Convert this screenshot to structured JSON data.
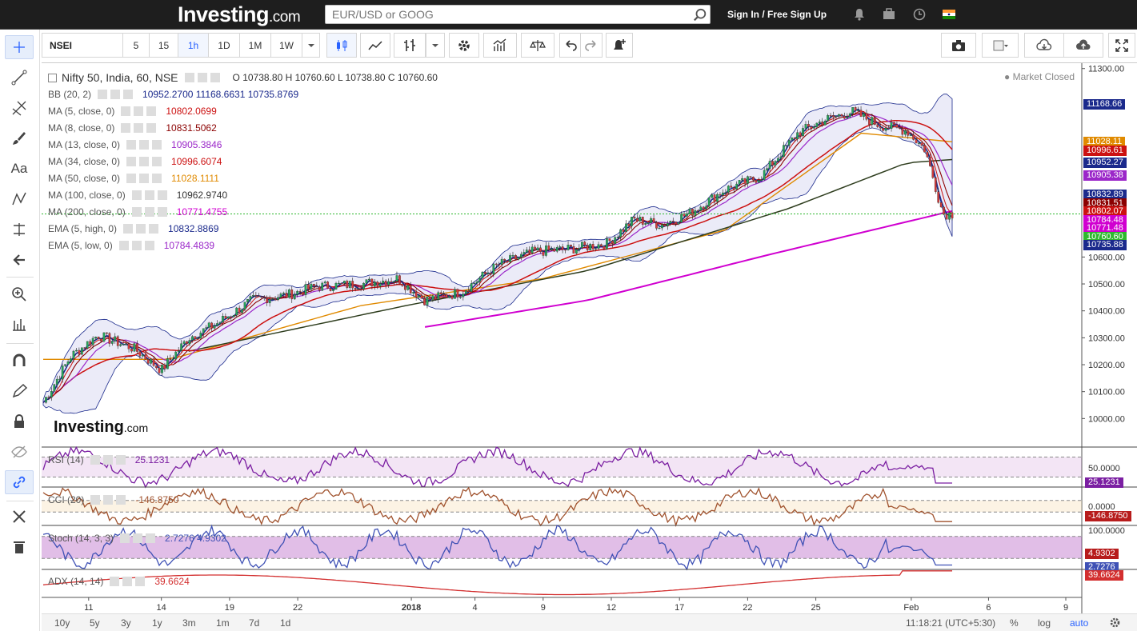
{
  "header": {
    "logo": "Investing",
    "logo_suffix": ".com",
    "search_placeholder": "EUR/USD or GOOG",
    "sign_in": "Sign In",
    "separator": "/",
    "sign_up": "Free Sign Up"
  },
  "toolbar": {
    "symbol": "NSEI",
    "intervals": [
      "5",
      "15",
      "1h",
      "1D",
      "1M",
      "1W"
    ],
    "selected_interval": "1h"
  },
  "legend": {
    "title": "Nifty 50, India, 60, NSE",
    "ohlc": "O 10738.80 H 10760.60 L 10738.80 C 10760.60",
    "market_status": "Market Closed",
    "indicators": [
      {
        "label": "BB (20, 2)",
        "value": "10952.2700  11168.6631  10735.8769",
        "color": "#1b2a8c"
      },
      {
        "label": "MA (5, close, 0)",
        "value": "10802.0699",
        "color": "#cc1111"
      },
      {
        "label": "MA (8, close, 0)",
        "value": "10831.5062",
        "color": "#8b0000"
      },
      {
        "label": "MA (13, close, 0)",
        "value": "10905.3846",
        "color": "#9b27c9"
      },
      {
        "label": "MA (34, close, 0)",
        "value": "10996.6074",
        "color": "#cc1111"
      },
      {
        "label": "MA (50, close, 0)",
        "value": "11028.1111",
        "color": "#e08a00"
      },
      {
        "label": "MA (100, close, 0)",
        "value": "10962.9740",
        "color": "#333333"
      },
      {
        "label": "MA (200, close, 0)",
        "value": "10771.4755",
        "color": "#d000d0"
      },
      {
        "label": "EMA (5, high, 0)",
        "value": "10832.8869",
        "color": "#1b2a8c"
      },
      {
        "label": "EMA (5, low, 0)",
        "value": "10784.4839",
        "color": "#9b27c9"
      }
    ]
  },
  "watermark": {
    "text": "Investing",
    "suffix": ".com"
  },
  "chart_data": [
    {
      "type": "candlestick",
      "name": "Nifty 50 60min",
      "x_ticks": [
        "11",
        "14",
        "19",
        "22",
        "2018",
        "4",
        "9",
        "12",
        "17",
        "22",
        "25",
        "Feb",
        "6",
        "9"
      ],
      "y_ticks": [
        "11300.00",
        "10600.00",
        "10500.00",
        "10400.00",
        "10300.00",
        "10200.00",
        "10100.00",
        "10000.00"
      ],
      "ylim": [
        9900,
        11320
      ],
      "close_path": [
        [
          0,
          10060
        ],
        [
          0.03,
          10230
        ],
        [
          0.06,
          10310
        ],
        [
          0.1,
          10260
        ],
        [
          0.13,
          10180
        ],
        [
          0.16,
          10300
        ],
        [
          0.19,
          10350
        ],
        [
          0.23,
          10440
        ],
        [
          0.27,
          10460
        ],
        [
          0.3,
          10490
        ],
        [
          0.35,
          10500
        ],
        [
          0.39,
          10520
        ],
        [
          0.42,
          10440
        ],
        [
          0.46,
          10470
        ],
        [
          0.5,
          10570
        ],
        [
          0.54,
          10620
        ],
        [
          0.58,
          10630
        ],
        [
          0.62,
          10650
        ],
        [
          0.65,
          10740
        ],
        [
          0.68,
          10720
        ],
        [
          0.71,
          10760
        ],
        [
          0.75,
          10850
        ],
        [
          0.79,
          10900
        ],
        [
          0.83,
          11060
        ],
        [
          0.86,
          11110
        ],
        [
          0.89,
          11140
        ],
        [
          0.92,
          11090
        ],
        [
          0.95,
          11070
        ],
        [
          0.97,
          11000
        ],
        [
          0.99,
          10760
        ]
      ],
      "ma200_path": [
        [
          0.42,
          10340
        ],
        [
          0.6,
          10440
        ],
        [
          0.8,
          10610
        ],
        [
          1,
          10771
        ]
      ],
      "ma100_path": [
        [
          0.16,
          10250
        ],
        [
          0.4,
          10420
        ],
        [
          0.6,
          10550
        ],
        [
          0.82,
          10780
        ],
        [
          0.95,
          10950
        ],
        [
          1,
          10962
        ]
      ],
      "ma50_path": [
        [
          0,
          10220
        ],
        [
          0.14,
          10220
        ],
        [
          0.35,
          10420
        ],
        [
          0.55,
          10520
        ],
        [
          0.75,
          10700
        ],
        [
          0.9,
          11060
        ],
        [
          1,
          11028
        ]
      ],
      "price_labels": [
        {
          "text": "11028.11",
          "value": 11028,
          "color": "#e08a00"
        },
        {
          "text": "10996.61",
          "value": 10996,
          "color": "#cc1111"
        },
        {
          "text": "11168.66",
          "value": 11168,
          "color": "#1b2a8c"
        },
        {
          "text": "10952.27",
          "value": 10952,
          "color": "#1b2a8c"
        },
        {
          "text": "10905.38",
          "value": 10905,
          "color": "#9b27c9"
        },
        {
          "text": "10832.89",
          "value": 10832,
          "color": "#1b2a8c"
        },
        {
          "text": "10831.51",
          "value": 10831,
          "color": "#8b0000"
        },
        {
          "text": "10802.07",
          "value": 10802,
          "color": "#cc1111"
        },
        {
          "text": "10784.48",
          "value": 10784,
          "color": "#d000d0"
        },
        {
          "text": "10771.48",
          "value": 10771,
          "color": "#d000d0"
        },
        {
          "text": "10760.60",
          "value": 10760,
          "color": "#2eb82e"
        },
        {
          "text": "10735.88",
          "value": 10735,
          "color": "#1b2a8c"
        }
      ]
    },
    {
      "type": "line",
      "name": "RSI (14)",
      "value_label": "25.1231",
      "series_value": 25.1231,
      "y_ticks": [
        "50.0000"
      ],
      "color": "#7b1fa2"
    },
    {
      "type": "line",
      "name": "CCI (20)",
      "value_label": "-146.8750",
      "series_value": -146.875,
      "y_ticks": [
        "0.0000"
      ],
      "color": "#a0522d"
    },
    {
      "type": "line",
      "name": "Stoch (14, 3, 3)",
      "value_label": "2.7276  4.9302",
      "k": 2.7276,
      "d": 4.9302,
      "y_ticks": [
        "100.0000"
      ],
      "color": "#3f51b5"
    },
    {
      "type": "line",
      "name": "ADX (14, 14)",
      "value_label": "39.6624",
      "series_value": 39.6624,
      "color": "#d32f2f"
    }
  ],
  "indicator_labels": {
    "rsi_name": "RSI (14)",
    "rsi_val": "25.1231",
    "rsi_tick": "50.0000",
    "rsi_right": "25.1231",
    "cci_name": "CCI (20)",
    "cci_val": "-146.8750",
    "cci_tick": "0.0000",
    "cci_right": "-146.8750",
    "stoch_name": "Stoch (14, 3, 3)",
    "stoch_val": "2.7276  4.9302",
    "stoch_tick": "100.0000",
    "stoch_right1": "4.9302",
    "stoch_right2": "2.7276",
    "adx_name": "ADX (14, 14)",
    "adx_val": "39.6624",
    "adx_right": "39.6624"
  },
  "bottom": {
    "ranges": [
      "10y",
      "5y",
      "3y",
      "1y",
      "3m",
      "1m",
      "7d",
      "1d"
    ],
    "clock": "11:18:21 (UTC+5:30)",
    "percent": "%",
    "log": "log",
    "auto": "auto"
  }
}
